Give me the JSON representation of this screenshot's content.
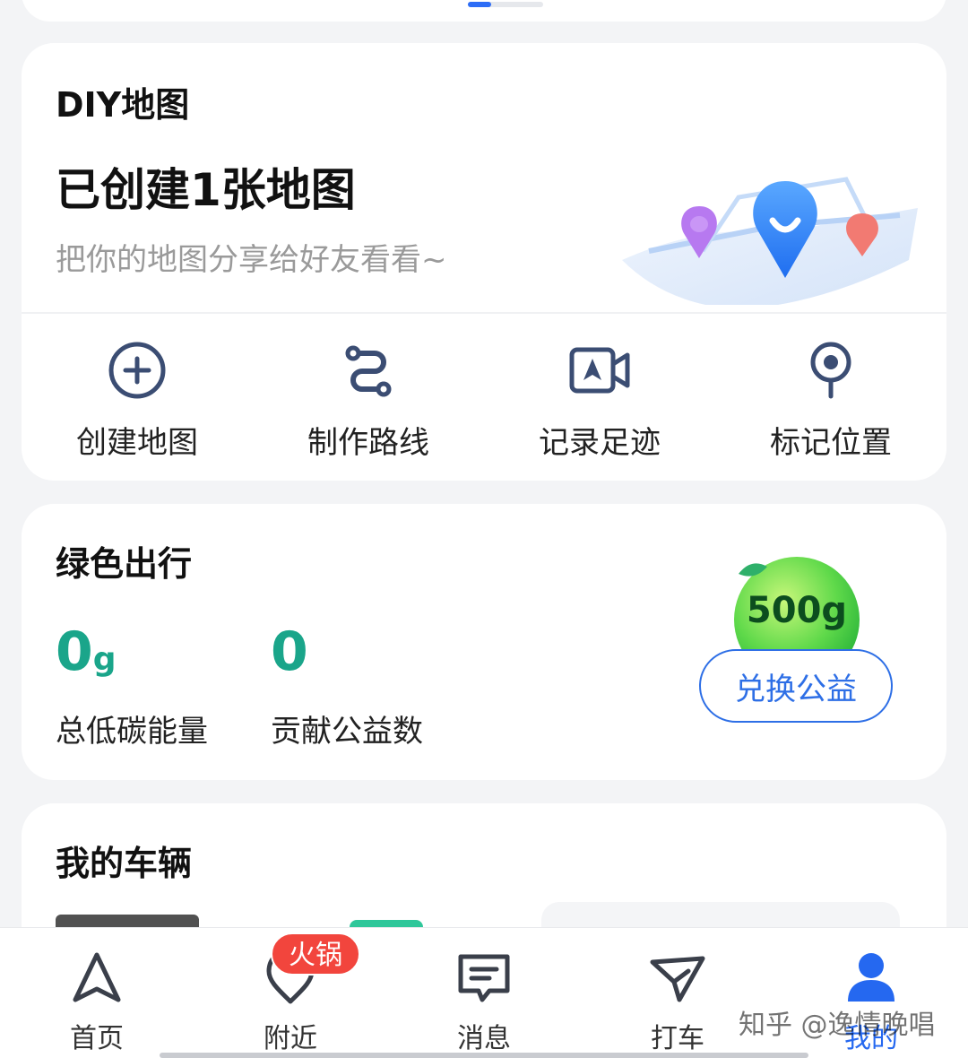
{
  "diy": {
    "title": "DIY地图",
    "count_text": "已创建1张地图",
    "subtitle": "把你的地图分享给好友看看~",
    "actions": [
      {
        "label": "创建地图",
        "icon": "plus-circle-icon"
      },
      {
        "label": "制作路线",
        "icon": "route-icon"
      },
      {
        "label": "记录足迹",
        "icon": "video-camera-icon"
      },
      {
        "label": "标记位置",
        "icon": "location-pin-icon"
      }
    ]
  },
  "green": {
    "title": "绿色出行",
    "energy_value": "0",
    "energy_unit": "g",
    "energy_label": "总低碳能量",
    "donation_value": "0",
    "donation_label": "贡献公益数",
    "ball_text": "500g",
    "exchange_label": "兑换公益"
  },
  "vehicle": {
    "title": "我的车辆"
  },
  "tabbar": {
    "tabs": [
      {
        "label": "首页",
        "icon": "navigation-arrow-icon"
      },
      {
        "label": "附近",
        "icon": "location-heart-icon"
      },
      {
        "label": "消息",
        "icon": "message-icon"
      },
      {
        "label": "打车",
        "icon": "taxi-arrow-icon"
      },
      {
        "label": "我的",
        "icon": "person-icon"
      }
    ],
    "badge": "火锅"
  },
  "watermark": "知乎 @逸情晚唱",
  "colors": {
    "accent": "#2e6fe6",
    "green": "#1aa58a",
    "badge": "#f2453d",
    "background": "#f3f4f6"
  }
}
